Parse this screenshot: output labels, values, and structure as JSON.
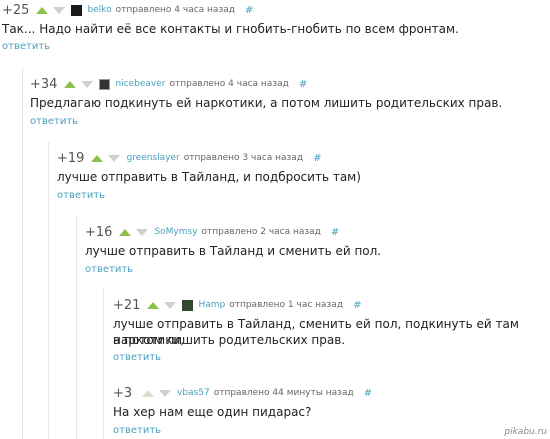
{
  "comments": [
    {
      "rating": "+25",
      "username": "belko",
      "posted": "отправлено 4 часа назад",
      "link": "#",
      "text": "Так... Надо найти её все контакты и гнобить-гнобить по всем фронтам.",
      "reply": "ответить"
    },
    {
      "rating": "+34",
      "username": "nicebeaver",
      "posted": "отправлено 4 часа назад",
      "link": "#",
      "text": "Предлагаю подкинуть ей наркотики, а потом лишить родительских прав.",
      "reply": "ответить"
    },
    {
      "rating": "+19",
      "username": "greenslayer",
      "posted": "отправлено 3 часа назад",
      "link": "#",
      "text": "лучше отправить в Тайланд, и подбросить там)",
      "reply": "ответить"
    },
    {
      "rating": "+16",
      "username": "SoMymsy",
      "posted": "отправлено 2 часа назад",
      "link": "#",
      "text": "лучше отправить в Тайланд и сменить ей пол.",
      "reply": "ответить"
    },
    {
      "rating": "+21",
      "username": "Hamp",
      "posted": "отправлено 1 час назад",
      "link": "#",
      "text_line1": "лучше отправить в Тайланд, сменить ей пол, подкинуть ей там наркотики,",
      "text_line2": "а потом лишить родительских прав.",
      "reply": "ответить"
    },
    {
      "rating": "+3",
      "username": "vbas57",
      "posted": "отправлено 44 минуты назад",
      "link": "#",
      "text": "На хер нам еще один пидарас?",
      "reply": "ответить"
    }
  ],
  "watermark": "pikabu.ru"
}
